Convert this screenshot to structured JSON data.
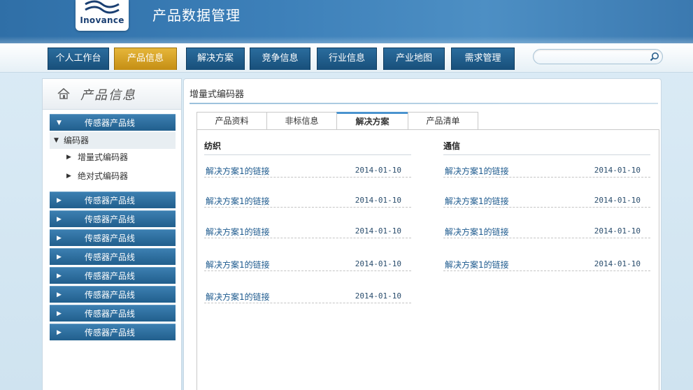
{
  "brand": {
    "logo_text": "Inovance",
    "app_title": "产品数据管理"
  },
  "nav": {
    "tabs": [
      {
        "label": "个人工作台"
      },
      {
        "label": "产品信息",
        "active": true
      },
      {
        "label": "解决方案"
      },
      {
        "label": "竞争信息"
      },
      {
        "label": "行业信息"
      },
      {
        "label": "产业地图"
      },
      {
        "label": "需求管理"
      }
    ],
    "search": {
      "value": "",
      "placeholder": ""
    }
  },
  "sidebar": {
    "title": "产品信息",
    "groups": [
      {
        "label": "传感器产品线",
        "expanded": true
      },
      {
        "label": "传感器产品线"
      },
      {
        "label": "传感器产品线"
      },
      {
        "label": "传感器产品线"
      },
      {
        "label": "传感器产品线"
      },
      {
        "label": "传感器产品线"
      },
      {
        "label": "传感器产品线"
      },
      {
        "label": "传感器产品线"
      },
      {
        "label": "传感器产品线"
      }
    ],
    "sub": {
      "label": "编码器"
    },
    "leaves": [
      {
        "label": "增量式编码器"
      },
      {
        "label": "绝对式编码器"
      }
    ]
  },
  "main": {
    "title": "增量式编码器",
    "tabs": [
      {
        "label": "产品资料"
      },
      {
        "label": "非标信息"
      },
      {
        "label": "解决方案",
        "active": true
      },
      {
        "label": "产品清单"
      }
    ],
    "columns": [
      {
        "heading": "纺织",
        "items": [
          {
            "text": "解决方案1的链接",
            "date": "2014-01-10"
          },
          {
            "text": "解决方案1的链接",
            "date": "2014-01-10"
          },
          {
            "text": "解决方案1的链接",
            "date": "2014-01-10"
          },
          {
            "text": "解决方案1的链接",
            "date": "2014-01-10"
          },
          {
            "text": "解决方案1的链接",
            "date": "2014-01-10"
          }
        ]
      },
      {
        "heading": "通信",
        "items": [
          {
            "text": "解决方案1的链接",
            "date": "2014-01-10"
          },
          {
            "text": "解决方案1的链接",
            "date": "2014-01-10"
          },
          {
            "text": "解决方案1的链接",
            "date": "2014-01-10"
          },
          {
            "text": "解决方案1的链接",
            "date": "2014-01-10"
          }
        ]
      }
    ]
  },
  "colors": {
    "header_blue": "#3d80b9",
    "nav_tab": "#1e5c8a",
    "nav_active": "#d9a326",
    "sidebar_head": "#2d6d9e",
    "link": "#1d5a8e",
    "tab_accent": "#4a93cf"
  },
  "icons": {
    "logo": "inovance-wave-logo",
    "home": "home-icon",
    "search": "search-icon",
    "expanded": "triangle-down-icon",
    "collapsed": "triangle-right-icon"
  }
}
